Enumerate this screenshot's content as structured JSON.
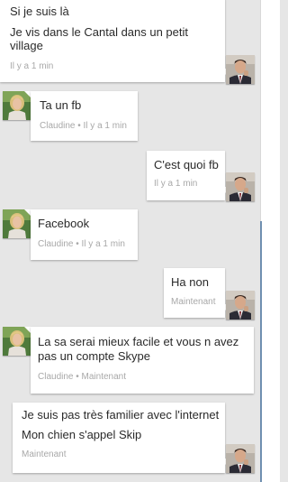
{
  "messages": [
    {
      "sender": "me",
      "lines": [
        "Si je suis là",
        "Je vis dans le Cantal dans un petit",
        "village"
      ],
      "meta": "Il y a 1 min"
    },
    {
      "sender": "claudine",
      "lines": [
        "Ta un fb"
      ],
      "meta": "Claudine • Il y a 1 min"
    },
    {
      "sender": "me",
      "lines": [
        "C'est quoi fb"
      ],
      "meta": "Il y a 1 min"
    },
    {
      "sender": "claudine",
      "lines": [
        "Facebook"
      ],
      "meta": "Claudine • Il y a 1 min"
    },
    {
      "sender": "me",
      "lines": [
        "Ha non"
      ],
      "meta": "Maintenant"
    },
    {
      "sender": "claudine",
      "lines": [
        "La sa serai mieux facile et vous n avez",
        "pas un compte Skype"
      ],
      "meta": "Claudine • Maintenant"
    },
    {
      "sender": "me",
      "lines": [
        "Je suis pas très familier avec l'internet",
        "Mon chien s'appel Skip"
      ],
      "meta": "Maintenant"
    }
  ],
  "colors": {
    "background": "#e6e6e6",
    "bubble": "#ffffff",
    "text": "#2a2a2a",
    "meta": "#a8a8a8",
    "scrollbar_thumb": "#6f8fb0"
  },
  "avatars": {
    "me": "man-in-suit-avatar",
    "claudine": "woman-blonde-avatar"
  }
}
